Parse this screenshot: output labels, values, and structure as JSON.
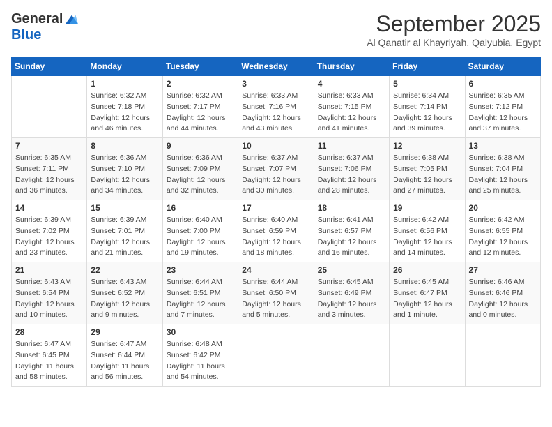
{
  "logo": {
    "general": "General",
    "blue": "Blue"
  },
  "title": "September 2025",
  "location": "Al Qanatir al Khayriyah, Qalyubia, Egypt",
  "weekdays": [
    "Sunday",
    "Monday",
    "Tuesday",
    "Wednesday",
    "Thursday",
    "Friday",
    "Saturday"
  ],
  "weeks": [
    [
      {
        "day": "",
        "info": ""
      },
      {
        "day": "1",
        "info": "Sunrise: 6:32 AM\nSunset: 7:18 PM\nDaylight: 12 hours\nand 46 minutes."
      },
      {
        "day": "2",
        "info": "Sunrise: 6:32 AM\nSunset: 7:17 PM\nDaylight: 12 hours\nand 44 minutes."
      },
      {
        "day": "3",
        "info": "Sunrise: 6:33 AM\nSunset: 7:16 PM\nDaylight: 12 hours\nand 43 minutes."
      },
      {
        "day": "4",
        "info": "Sunrise: 6:33 AM\nSunset: 7:15 PM\nDaylight: 12 hours\nand 41 minutes."
      },
      {
        "day": "5",
        "info": "Sunrise: 6:34 AM\nSunset: 7:14 PM\nDaylight: 12 hours\nand 39 minutes."
      },
      {
        "day": "6",
        "info": "Sunrise: 6:35 AM\nSunset: 7:12 PM\nDaylight: 12 hours\nand 37 minutes."
      }
    ],
    [
      {
        "day": "7",
        "info": "Sunrise: 6:35 AM\nSunset: 7:11 PM\nDaylight: 12 hours\nand 36 minutes."
      },
      {
        "day": "8",
        "info": "Sunrise: 6:36 AM\nSunset: 7:10 PM\nDaylight: 12 hours\nand 34 minutes."
      },
      {
        "day": "9",
        "info": "Sunrise: 6:36 AM\nSunset: 7:09 PM\nDaylight: 12 hours\nand 32 minutes."
      },
      {
        "day": "10",
        "info": "Sunrise: 6:37 AM\nSunset: 7:07 PM\nDaylight: 12 hours\nand 30 minutes."
      },
      {
        "day": "11",
        "info": "Sunrise: 6:37 AM\nSunset: 7:06 PM\nDaylight: 12 hours\nand 28 minutes."
      },
      {
        "day": "12",
        "info": "Sunrise: 6:38 AM\nSunset: 7:05 PM\nDaylight: 12 hours\nand 27 minutes."
      },
      {
        "day": "13",
        "info": "Sunrise: 6:38 AM\nSunset: 7:04 PM\nDaylight: 12 hours\nand 25 minutes."
      }
    ],
    [
      {
        "day": "14",
        "info": "Sunrise: 6:39 AM\nSunset: 7:02 PM\nDaylight: 12 hours\nand 23 minutes."
      },
      {
        "day": "15",
        "info": "Sunrise: 6:39 AM\nSunset: 7:01 PM\nDaylight: 12 hours\nand 21 minutes."
      },
      {
        "day": "16",
        "info": "Sunrise: 6:40 AM\nSunset: 7:00 PM\nDaylight: 12 hours\nand 19 minutes."
      },
      {
        "day": "17",
        "info": "Sunrise: 6:40 AM\nSunset: 6:59 PM\nDaylight: 12 hours\nand 18 minutes."
      },
      {
        "day": "18",
        "info": "Sunrise: 6:41 AM\nSunset: 6:57 PM\nDaylight: 12 hours\nand 16 minutes."
      },
      {
        "day": "19",
        "info": "Sunrise: 6:42 AM\nSunset: 6:56 PM\nDaylight: 12 hours\nand 14 minutes."
      },
      {
        "day": "20",
        "info": "Sunrise: 6:42 AM\nSunset: 6:55 PM\nDaylight: 12 hours\nand 12 minutes."
      }
    ],
    [
      {
        "day": "21",
        "info": "Sunrise: 6:43 AM\nSunset: 6:54 PM\nDaylight: 12 hours\nand 10 minutes."
      },
      {
        "day": "22",
        "info": "Sunrise: 6:43 AM\nSunset: 6:52 PM\nDaylight: 12 hours\nand 9 minutes."
      },
      {
        "day": "23",
        "info": "Sunrise: 6:44 AM\nSunset: 6:51 PM\nDaylight: 12 hours\nand 7 minutes."
      },
      {
        "day": "24",
        "info": "Sunrise: 6:44 AM\nSunset: 6:50 PM\nDaylight: 12 hours\nand 5 minutes."
      },
      {
        "day": "25",
        "info": "Sunrise: 6:45 AM\nSunset: 6:49 PM\nDaylight: 12 hours\nand 3 minutes."
      },
      {
        "day": "26",
        "info": "Sunrise: 6:45 AM\nSunset: 6:47 PM\nDaylight: 12 hours\nand 1 minute."
      },
      {
        "day": "27",
        "info": "Sunrise: 6:46 AM\nSunset: 6:46 PM\nDaylight: 12 hours\nand 0 minutes."
      }
    ],
    [
      {
        "day": "28",
        "info": "Sunrise: 6:47 AM\nSunset: 6:45 PM\nDaylight: 11 hours\nand 58 minutes."
      },
      {
        "day": "29",
        "info": "Sunrise: 6:47 AM\nSunset: 6:44 PM\nDaylight: 11 hours\nand 56 minutes."
      },
      {
        "day": "30",
        "info": "Sunrise: 6:48 AM\nSunset: 6:42 PM\nDaylight: 11 hours\nand 54 minutes."
      },
      {
        "day": "",
        "info": ""
      },
      {
        "day": "",
        "info": ""
      },
      {
        "day": "",
        "info": ""
      },
      {
        "day": "",
        "info": ""
      }
    ]
  ]
}
